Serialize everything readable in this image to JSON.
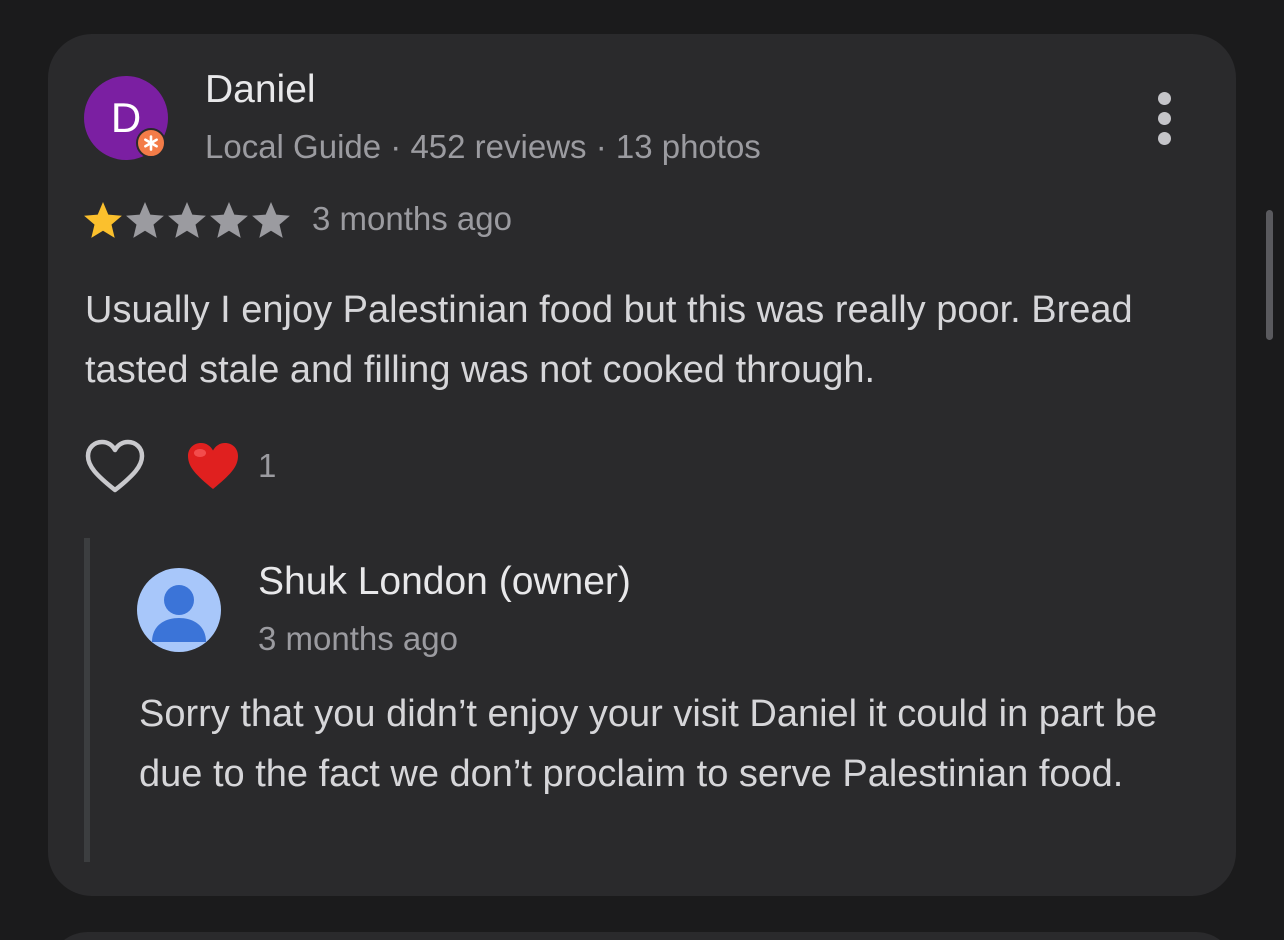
{
  "review": {
    "reviewer": {
      "initial": "D",
      "name": "Daniel",
      "meta": "Local Guide · 452 reviews · 13 photos",
      "avatar_color": "#7b1fa2",
      "badge_icon": "local-guide-badge-icon",
      "badge_color": "#f37c48"
    },
    "rating": 1,
    "rating_max": 5,
    "star_filled_color": "#fbc02d",
    "star_empty_color": "#9b9ba0",
    "time": "3 months ago",
    "text": "Usually I enjoy Palestinian food but this was really poor. Bread tasted stale and filling was not cooked through.",
    "reactions": {
      "like_icon": "heart-outline-icon",
      "reaction_icon": "red-heart-emoji-icon",
      "count": "1"
    },
    "more_icon": "more-vertical-icon"
  },
  "owner_reply": {
    "name": "Shuk London (owner)",
    "time": "3 months ago",
    "text": "Sorry that you didn’t enjoy your visit Daniel it could in part be due to the fact we don’t proclaim to serve Palestinian food.",
    "avatar_icon": "default-profile-icon",
    "avatar_color": "#a8c7fa"
  },
  "colors": {
    "background": "#1b1b1c",
    "card": "#2a2a2c",
    "primary_text": "#e8e8ea",
    "secondary_text": "#9b9ba0"
  }
}
